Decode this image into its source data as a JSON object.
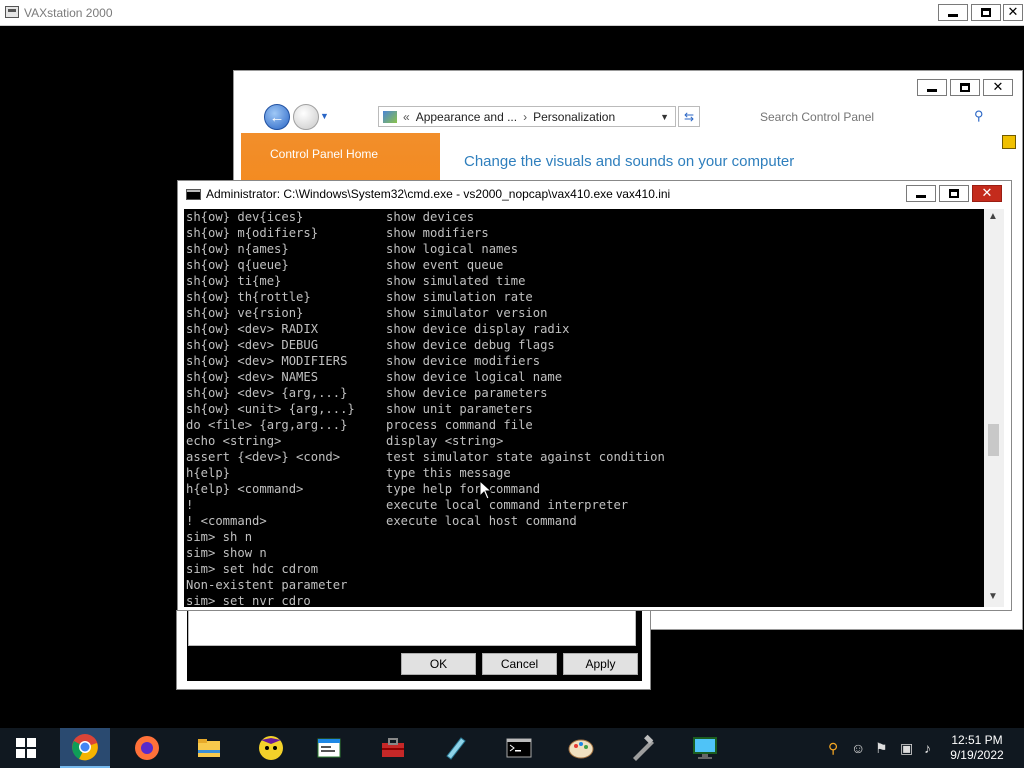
{
  "vax_window": {
    "title": "VAXstation 2000",
    "min_label": "",
    "max_label": "",
    "close_label": "✕"
  },
  "control_panel": {
    "breadcrumb": [
      "Appearance and ...",
      "Personalization"
    ],
    "search_placeholder": "Search Control Panel",
    "sidebar_link": "Control Panel Home",
    "heading": "Change the visuals and sounds on your computer",
    "close_label": "✕"
  },
  "dialog": {
    "ok_label": "OK",
    "cancel_label": "Cancel",
    "apply_label": "Apply"
  },
  "cmd": {
    "title": "Administrator: C:\\Windows\\System32\\cmd.exe - vs2000_nopcap\\vax410.exe  vax410.ini",
    "close_label": "✕",
    "help_lines": [
      {
        "cmd": "sh{ow} dev{ices}",
        "desc": "show devices"
      },
      {
        "cmd": "sh{ow} m{odifiers}",
        "desc": "show modifiers"
      },
      {
        "cmd": "sh{ow} n{ames}",
        "desc": "show logical names"
      },
      {
        "cmd": "sh{ow} q{ueue}",
        "desc": "show event queue"
      },
      {
        "cmd": "sh{ow} ti{me}",
        "desc": "show simulated time"
      },
      {
        "cmd": "sh{ow} th{rottle}",
        "desc": "show simulation rate"
      },
      {
        "cmd": "sh{ow} ve{rsion}",
        "desc": "show simulator version"
      },
      {
        "cmd": "sh{ow} <dev> RADIX",
        "desc": "show device display radix"
      },
      {
        "cmd": "sh{ow} <dev> DEBUG",
        "desc": "show device debug flags"
      },
      {
        "cmd": "sh{ow} <dev> MODIFIERS",
        "desc": "show device modifiers"
      },
      {
        "cmd": "sh{ow} <dev> NAMES",
        "desc": "show device logical name"
      },
      {
        "cmd": "sh{ow} <dev> {arg,...}",
        "desc": "show device parameters"
      },
      {
        "cmd": "sh{ow} <unit> {arg,...}",
        "desc": "show unit parameters"
      },
      {
        "cmd": "do <file> {arg,arg...}",
        "desc": "process command file"
      },
      {
        "cmd": "echo <string>",
        "desc": "display <string>"
      },
      {
        "cmd": "assert {<dev>} <cond>",
        "desc": "test simulator state against condition"
      },
      {
        "cmd": "h{elp}",
        "desc": "type this message"
      },
      {
        "cmd": "h{elp} <command>",
        "desc": "type help for command"
      },
      {
        "cmd": "!",
        "desc": "execute local command interpreter"
      },
      {
        "cmd": "! <command>",
        "desc": "execute local host command"
      }
    ],
    "session_lines": [
      "sim> sh n",
      "sim> show n",
      "sim> set hdc cdrom",
      "Non-existent parameter",
      "sim> set nvr cdro"
    ]
  },
  "taskbar": {
    "apps": [
      "Start",
      "Google Chrome",
      "Firefox",
      "File Explorer",
      "Yahoo Messenger",
      "Notepad",
      "Toolbox",
      "Editor",
      "Command Prompt",
      "Paint",
      "Tools",
      "Remote Desktop"
    ],
    "time": "12:51 PM",
    "date": "9/19/2022"
  }
}
